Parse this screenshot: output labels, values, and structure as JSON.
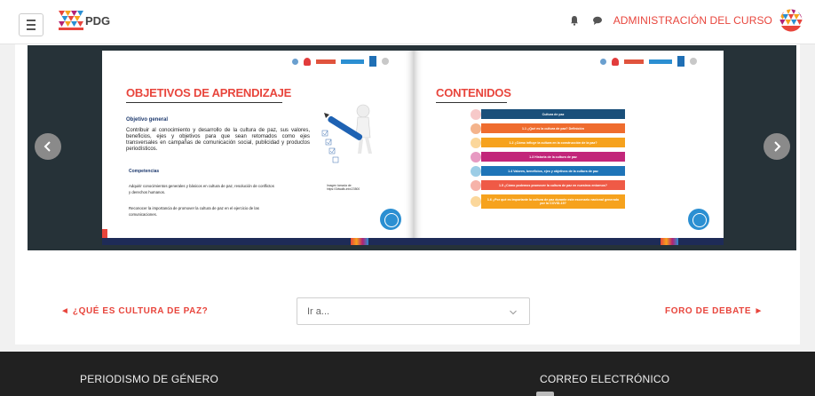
{
  "navbar": {
    "logo_text": "PDG",
    "admin_label": "ADMINISTRACIÓN DEL CURSO",
    "icons": [
      "menu-icon",
      "bell-icon",
      "chat-icon",
      "avatar"
    ]
  },
  "slide_left": {
    "title": "OBJETIVOS DE APRENDIZAJE",
    "general_heading": "Objetivo general",
    "general_text": "Contribuir al conocimiento y desarrollo de la cultura de paz, sus valores, beneficios, ejes y objetivos para que sean retomados como ejes transversales en campañas de comunicación social, publicidad y productos periodísticos.",
    "competencias_heading": "Competencias",
    "competencia_1": "Adquirir conocimientos generales y básicos en cultura de paz, resolución de conflictos y derechos humanos.",
    "competencia_2": "Reconocer la importancia de promover la cultura de paz en el ejercicio de las comunicaciones.",
    "image_credit": "Imagen tomada de: https://3dwalls.info/23500"
  },
  "slide_right": {
    "title": "CONTENIDOS",
    "items": [
      {
        "label": "Cultura de paz",
        "color": "#1a4f7a"
      },
      {
        "label": "1.1 ¿Qué es la cultura de paz? Definición",
        "color": "#ef6c2e"
      },
      {
        "label": "1.2 ¿Cómo influye la cultura en la construcción de la paz?",
        "color": "#f6a21d"
      },
      {
        "label": "1.3 Historia de la cultura de paz",
        "color": "#c2267a"
      },
      {
        "label": "1.4 Valores, beneficios, ejes y objetivos de la cultura de paz",
        "color": "#1e74b8"
      },
      {
        "label": "1.5 ¿Cómo podemos promover la cultura de paz en nuestros entornos?",
        "color": "#ef5a46"
      },
      {
        "label": "1.6 ¿Por qué es importante la cultura de paz durante este escenario nacional generado por la COVID-19?",
        "color": "#f6a21d"
      }
    ]
  },
  "navigation": {
    "prev_label": "◄ ¿QUÉ ES CULTURA DE PAZ?",
    "jump_value": "Ir a...",
    "next_label": "FORO DE DEBATE ►"
  },
  "footer": {
    "left_heading": "PERIODISMO DE GÉNERO",
    "right_heading": "CORREO ELECTRÓNICO"
  },
  "colors": {
    "accent": "#e8453c",
    "slider_bg": "#263238",
    "footer_bg": "#212121"
  }
}
